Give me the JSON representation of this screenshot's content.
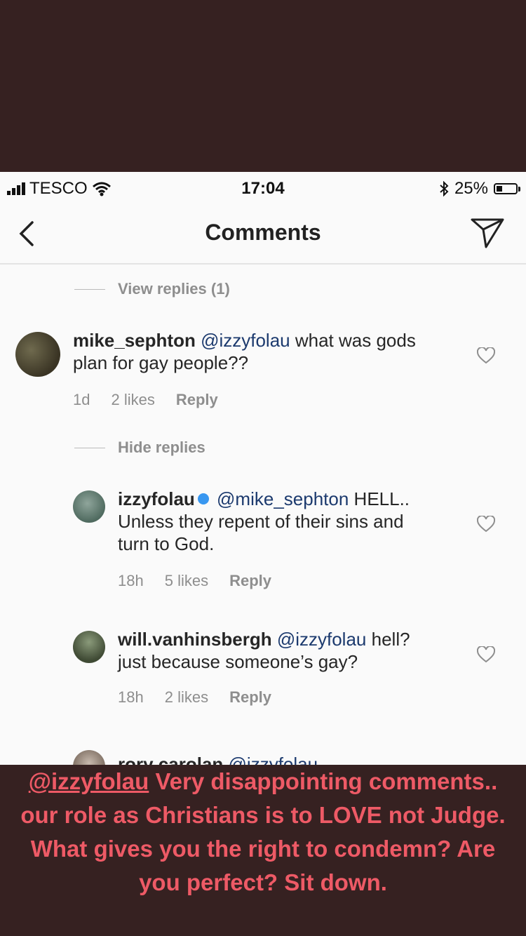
{
  "status_bar": {
    "carrier": "TESCO",
    "time": "17:04",
    "battery": "25%",
    "battery_level": 0.25
  },
  "nav": {
    "title": "Comments",
    "back_icon": "chevron-left-icon",
    "send_icon": "paper-plane-icon"
  },
  "comments": {
    "view_replies": "View replies (1)",
    "hide_replies": "Hide replies",
    "c1": {
      "username": "mike_sephton",
      "mention": "@izzyfolau",
      "text_line1": "what was gods",
      "text_line2": "plan for gay people??",
      "time": "1d",
      "likes": "2 likes",
      "reply": "Reply"
    },
    "c2": {
      "username": "izzyfolau",
      "mention": "@mike_sephton",
      "text_line1": "HELL..",
      "text_line2": "Unless they repent of their sins and",
      "text_line3": "turn to God.",
      "time": "18h",
      "likes": "5 likes",
      "reply": "Reply"
    },
    "c3": {
      "username": "will.vanhinsbergh",
      "mention": "@izzyfolau",
      "text_line1": "hell?",
      "text_line2": "just because someone’s gay?",
      "time": "18h",
      "likes": "2 likes",
      "reply": "Reply"
    },
    "c4": {
      "username": "rory carolan",
      "mention": "@izzyfolau"
    }
  },
  "caption": {
    "tag": "@izzyfolau",
    "line1": "Very disappointing comments..",
    "line2": "our role as Christians is to LOVE not Judge.",
    "line3": "What gives you the right to condemn? Are",
    "line4": "you perfect? Sit down."
  },
  "colors": {
    "background": "#362121",
    "caption_text": "#ee5a66",
    "mention": "#1c3a6e"
  }
}
